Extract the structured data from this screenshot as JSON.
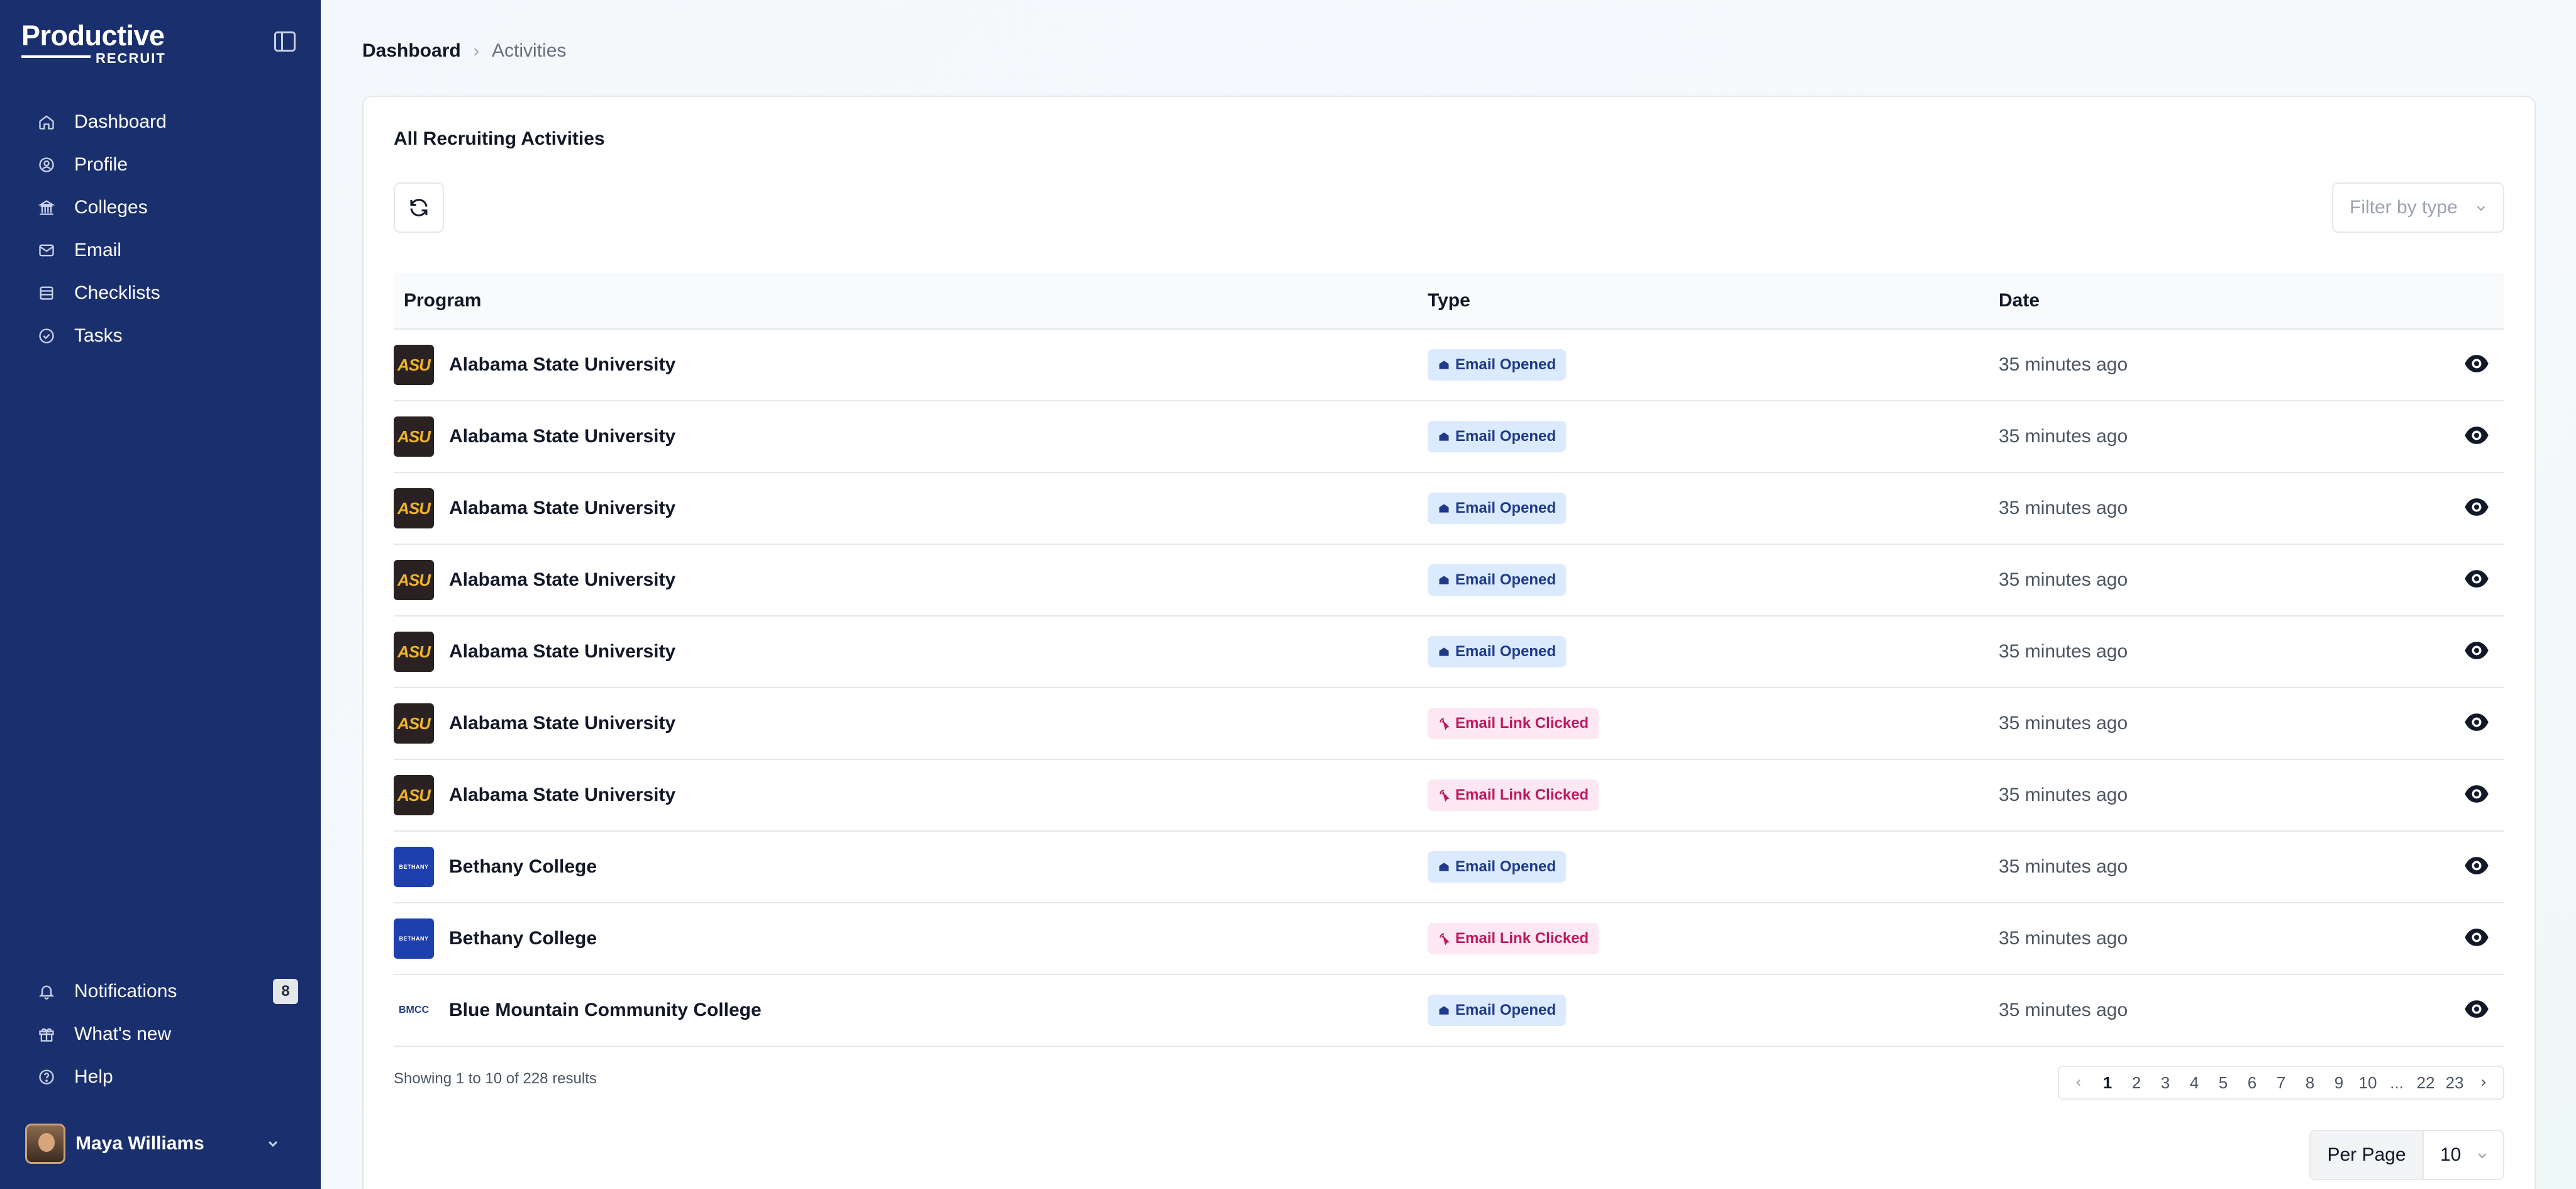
{
  "brand": {
    "name": "Productive",
    "sub": "RECRUIT"
  },
  "sidebar": {
    "items": [
      {
        "label": "Dashboard",
        "icon": "home-icon"
      },
      {
        "label": "Profile",
        "icon": "user-circle-icon"
      },
      {
        "label": "Colleges",
        "icon": "building-icon"
      },
      {
        "label": "Email",
        "icon": "mail-icon"
      },
      {
        "label": "Checklists",
        "icon": "list-icon"
      },
      {
        "label": "Tasks",
        "icon": "check-circle-icon"
      }
    ],
    "bottom": [
      {
        "label": "Notifications",
        "icon": "bell-icon",
        "badge": "8"
      },
      {
        "label": "What's new",
        "icon": "gift-icon"
      },
      {
        "label": "Help",
        "icon": "help-circle-icon"
      }
    ],
    "user": {
      "name": "Maya Williams"
    }
  },
  "breadcrumb": {
    "home": "Dashboard",
    "current": "Activities"
  },
  "card": {
    "title": "All Recruiting Activities",
    "filter_placeholder": "Filter by type"
  },
  "table": {
    "headers": {
      "program": "Program",
      "type": "Type",
      "date": "Date"
    },
    "rows": [
      {
        "program": "Alabama State University",
        "logo": "ASU",
        "type": "Email Opened",
        "date": "35 minutes ago"
      },
      {
        "program": "Alabama State University",
        "logo": "ASU",
        "type": "Email Opened",
        "date": "35 minutes ago"
      },
      {
        "program": "Alabama State University",
        "logo": "ASU",
        "type": "Email Opened",
        "date": "35 minutes ago"
      },
      {
        "program": "Alabama State University",
        "logo": "ASU",
        "type": "Email Opened",
        "date": "35 minutes ago"
      },
      {
        "program": "Alabama State University",
        "logo": "ASU",
        "type": "Email Opened",
        "date": "35 minutes ago"
      },
      {
        "program": "Alabama State University",
        "logo": "ASU",
        "type": "Email Link Clicked",
        "date": "35 minutes ago"
      },
      {
        "program": "Alabama State University",
        "logo": "ASU",
        "type": "Email Link Clicked",
        "date": "35 minutes ago"
      },
      {
        "program": "Bethany College",
        "logo": "BETHANY",
        "type": "Email Opened",
        "date": "35 minutes ago"
      },
      {
        "program": "Bethany College",
        "logo": "BETHANY",
        "type": "Email Link Clicked",
        "date": "35 minutes ago"
      },
      {
        "program": "Blue Mountain Community College",
        "logo": "BMCC",
        "type": "Email Opened",
        "date": "35 minutes ago"
      }
    ]
  },
  "footer": {
    "summary": "Showing 1 to 10 of 228 results",
    "pages": [
      "1",
      "2",
      "3",
      "4",
      "5",
      "6",
      "7",
      "8",
      "9",
      "10",
      "...",
      "22",
      "23"
    ],
    "active_page": "1",
    "per_page_label": "Per Page",
    "per_page_value": "10"
  }
}
